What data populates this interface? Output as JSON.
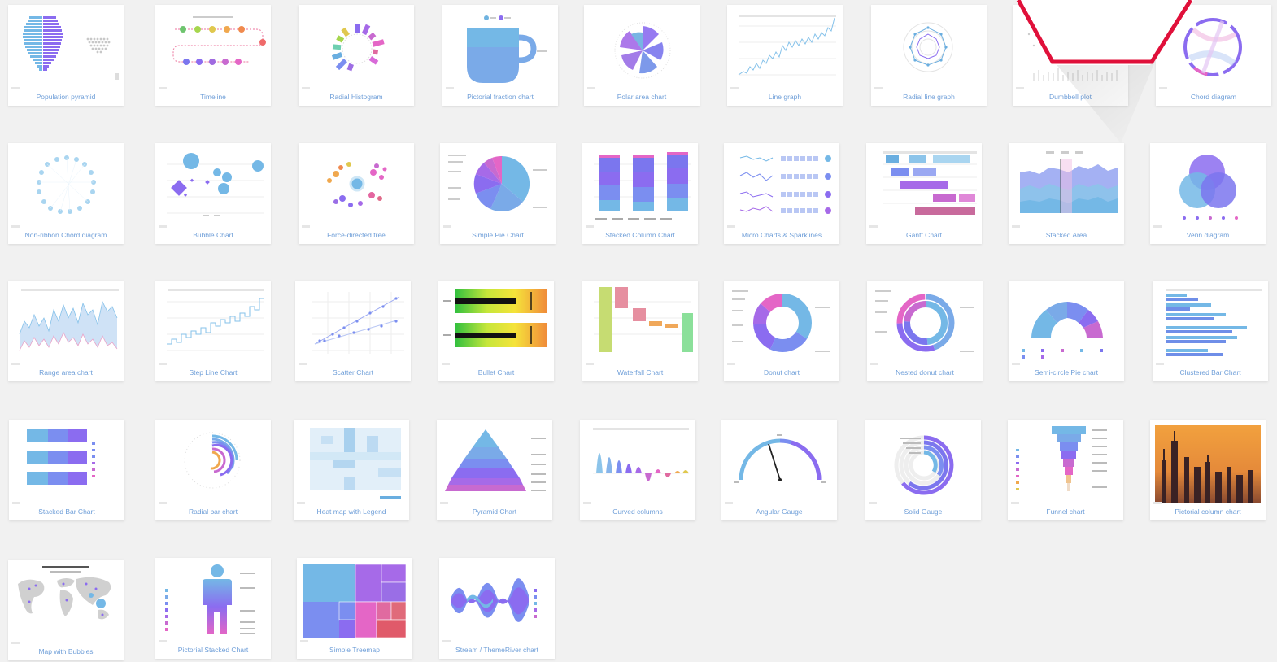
{
  "gallery": {
    "cards": [
      {
        "label": "Population pyramid",
        "icon": "population-pyramid"
      },
      {
        "label": "Timeline",
        "icon": "timeline"
      },
      {
        "label": "Radial Histogram",
        "icon": "radial-histogram"
      },
      {
        "label": "Pictorial fraction chart",
        "icon": "pictorial-fraction"
      },
      {
        "label": "Polar area chart",
        "icon": "polar-area"
      },
      {
        "label": "Line graph",
        "icon": "line-graph"
      },
      {
        "label": "Radial line graph",
        "icon": "radial-line"
      },
      {
        "label": "Dumbbell plot",
        "icon": "dumbbell"
      },
      {
        "label": "Chord diagram",
        "icon": "chord"
      },
      {
        "label": "Non-ribbon Chord diagram",
        "icon": "non-ribbon-chord"
      },
      {
        "label": "Bubble Chart",
        "icon": "bubble"
      },
      {
        "label": "Force-directed tree",
        "icon": "force-tree"
      },
      {
        "label": "Simple Pie Chart",
        "icon": "pie"
      },
      {
        "label": "Stacked Column Chart",
        "icon": "stacked-column"
      },
      {
        "label": "Micro Charts & Sparklines",
        "icon": "sparklines"
      },
      {
        "label": "Gantt Chart",
        "icon": "gantt"
      },
      {
        "label": "Stacked Area",
        "icon": "stacked-area"
      },
      {
        "label": "Venn diagram",
        "icon": "venn"
      },
      {
        "label": "Range area chart",
        "icon": "range-area"
      },
      {
        "label": "Step Line Chart",
        "icon": "step-line"
      },
      {
        "label": "Scatter Chart",
        "icon": "scatter"
      },
      {
        "label": "Bullet Chart",
        "icon": "bullet"
      },
      {
        "label": "Waterfall Chart",
        "icon": "waterfall"
      },
      {
        "label": "Donut chart",
        "icon": "donut"
      },
      {
        "label": "Nested donut chart",
        "icon": "nested-donut"
      },
      {
        "label": "Semi-circle Pie chart",
        "icon": "semi-pie"
      },
      {
        "label": "Clustered Bar Chart",
        "icon": "clustered-bar"
      },
      {
        "label": "Stacked Bar Chart",
        "icon": "stacked-bar"
      },
      {
        "label": "Radial bar chart",
        "icon": "radial-bar"
      },
      {
        "label": "Heat map with Legend",
        "icon": "heatmap"
      },
      {
        "label": "Pyramid Chart",
        "icon": "pyramid"
      },
      {
        "label": "Curved columns",
        "icon": "curved-columns"
      },
      {
        "label": "Angular Gauge",
        "icon": "angular-gauge"
      },
      {
        "label": "Solid Gauge",
        "icon": "solid-gauge"
      },
      {
        "label": "Funnel chart",
        "icon": "funnel"
      },
      {
        "label": "Pictorial column chart",
        "icon": "pictorial-column"
      },
      {
        "label": "Map with Bubbles",
        "icon": "map-bubbles"
      },
      {
        "label": "Pictorial Stacked Chart",
        "icon": "pictorial-stacked"
      },
      {
        "label": "Simple Treemap",
        "icon": "treemap"
      },
      {
        "label": "Stream / ThemeRiver chart",
        "icon": "streamgraph"
      }
    ]
  },
  "colors": {
    "page_bg": "#f1f1f1",
    "label": "#6e9ed8",
    "accent_blue": "#6fb3e0",
    "accent_purple": "#8b6cf0",
    "accent_pink": "#e466c6",
    "overlay_red": "#e0103a"
  }
}
